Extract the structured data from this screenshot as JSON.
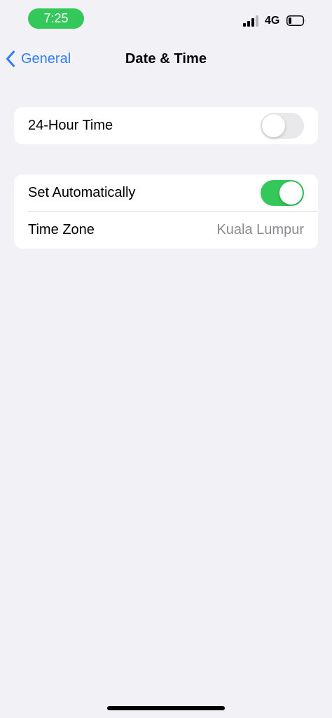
{
  "status_bar": {
    "time": "7:25",
    "network": "4G",
    "icons": [
      "signal-icon",
      "battery-icon"
    ]
  },
  "nav": {
    "back_label": "General",
    "title": "Date & Time",
    "back_icon": "chevron-left-icon"
  },
  "settings": {
    "hour24": {
      "label": "24-Hour Time",
      "enabled": false
    },
    "set_automatically": {
      "label": "Set Automatically",
      "enabled": true
    },
    "time_zone": {
      "label": "Time Zone",
      "value": "Kuala Lumpur"
    }
  },
  "colors": {
    "accent": "#2f7cf6",
    "toggle_on": "#34c759",
    "toggle_off": "#e9e9eb",
    "background": "#f2f1f6",
    "secondary_text": "#8b8a90"
  }
}
